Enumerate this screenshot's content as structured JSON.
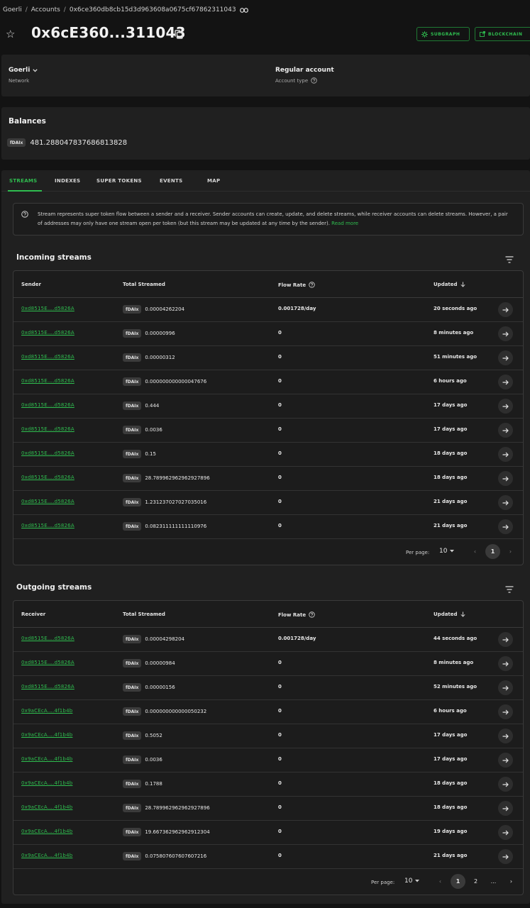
{
  "breadcrumb": [
    "Goerli",
    "Accounts",
    "0x6ce360db8cb15d3d963608a0675cf67862311043"
  ],
  "title": "0x6cE360...311043",
  "buttons": {
    "subgraph": "SUBGRAPH",
    "blockchain": "BLOCKCHAIN"
  },
  "network": {
    "value": "Goerli",
    "label": "Network",
    "account_type": "Regular account",
    "account_type_label": "Account type"
  },
  "balances": {
    "title": "Balances",
    "token": "fDAIx",
    "amount": "481.288047837686813828"
  },
  "tabs": [
    "STREAMS",
    "INDEXES",
    "SUPER TOKENS",
    "EVENTS",
    "MAP"
  ],
  "info": {
    "text": "Stream represents super token flow between a sender and a receiver. Sender accounts can create, update, and delete streams, while receiver accounts can delete streams. However, a pair of addresses may only have one stream open per token (but this stream may be updated at any time by the sender).",
    "link": "Read more"
  },
  "incoming": {
    "title": "Incoming streams",
    "headers": {
      "addr": "Sender",
      "total": "Total Streamed",
      "flow": "Flow Rate",
      "updated": "Updated"
    },
    "rows": [
      {
        "addr": "0xd8515E....d5826A",
        "token": "fDAIx",
        "total": "0.00004262204",
        "flow": "0.001728/day",
        "updated": "20 seconds ago"
      },
      {
        "addr": "0xd8515E....d5826A",
        "token": "fDAIx",
        "total": "0.00000996",
        "flow": "0",
        "updated": "8 minutes ago"
      },
      {
        "addr": "0xd8515E....d5826A",
        "token": "fDAIx",
        "total": "0.00000312",
        "flow": "0",
        "updated": "51 minutes ago"
      },
      {
        "addr": "0xd8515E....d5826A",
        "token": "fDAIx",
        "total": "0.000000000000047676",
        "flow": "0",
        "updated": "6 hours ago"
      },
      {
        "addr": "0xd8515E....d5826A",
        "token": "fDAIx",
        "total": "0.444",
        "flow": "0",
        "updated": "17 days ago"
      },
      {
        "addr": "0xd8515E....d5826A",
        "token": "fDAIx",
        "total": "0.0036",
        "flow": "0",
        "updated": "17 days ago"
      },
      {
        "addr": "0xd8515E....d5826A",
        "token": "fDAIx",
        "total": "0.15",
        "flow": "0",
        "updated": "18 days ago"
      },
      {
        "addr": "0xd8515E....d5826A",
        "token": "fDAIx",
        "total": "28.789962962962927896",
        "flow": "0",
        "updated": "18 days ago"
      },
      {
        "addr": "0xd8515E....d5826A",
        "token": "fDAIx",
        "total": "1.231237027027035016",
        "flow": "0",
        "updated": "21 days ago"
      },
      {
        "addr": "0xd8515E....d5826A",
        "token": "fDAIx",
        "total": "0.082311111111110976",
        "flow": "0",
        "updated": "21 days ago"
      }
    ],
    "per_page_label": "Per page:",
    "per_page": "10",
    "pages": [
      "1"
    ]
  },
  "outgoing": {
    "title": "Outgoing streams",
    "headers": {
      "addr": "Receiver",
      "total": "Total Streamed",
      "flow": "Flow Rate",
      "updated": "Updated"
    },
    "rows": [
      {
        "addr": "0xd8515E....d5826A",
        "token": "fDAIx",
        "total": "0.00004298204",
        "flow": "0.001728/day",
        "updated": "44 seconds ago"
      },
      {
        "addr": "0xd8515E....d5826A",
        "token": "fDAIx",
        "total": "0.00000984",
        "flow": "0",
        "updated": "8 minutes ago"
      },
      {
        "addr": "0xd8515E....d5826A",
        "token": "fDAIx",
        "total": "0.00000156",
        "flow": "0",
        "updated": "52 minutes ago"
      },
      {
        "addr": "0x9aCEcA....4f1b4b",
        "token": "fDAIx",
        "total": "0.000000000000050232",
        "flow": "0",
        "updated": "6 hours ago"
      },
      {
        "addr": "0x9aCEcA....4f1b4b",
        "token": "fDAIx",
        "total": "0.5052",
        "flow": "0",
        "updated": "17 days ago"
      },
      {
        "addr": "0x9aCEcA....4f1b4b",
        "token": "fDAIx",
        "total": "0.0036",
        "flow": "0",
        "updated": "17 days ago"
      },
      {
        "addr": "0x9aCEcA....4f1b4b",
        "token": "fDAIx",
        "total": "0.1788",
        "flow": "0",
        "updated": "18 days ago"
      },
      {
        "addr": "0x9aCEcA....4f1b4b",
        "token": "fDAIx",
        "total": "28.789962962962927896",
        "flow": "0",
        "updated": "18 days ago"
      },
      {
        "addr": "0x9aCEcA....4f1b4b",
        "token": "fDAIx",
        "total": "19.667362962962912304",
        "flow": "0",
        "updated": "19 days ago"
      },
      {
        "addr": "0x9aCEcA....4f1b4b",
        "token": "fDAIx",
        "total": "0.075807607607607216",
        "flow": "0",
        "updated": "21 days ago"
      }
    ],
    "per_page_label": "Per page:",
    "per_page": "10",
    "pages": [
      "1",
      "2",
      "..."
    ]
  }
}
